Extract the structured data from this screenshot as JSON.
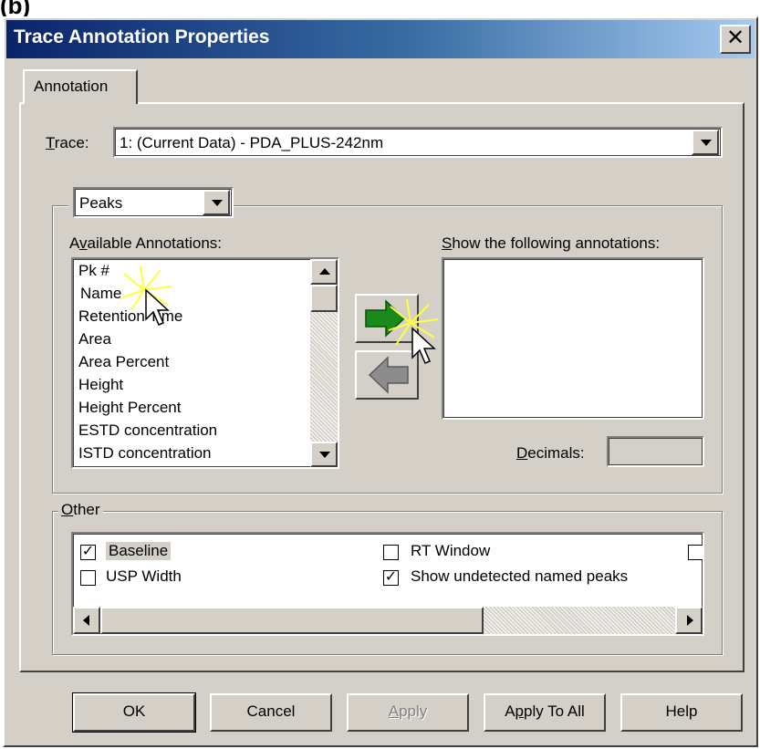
{
  "corner_label": "(b)",
  "window": {
    "title": "Trace Annotation Properties",
    "close_glyph": "✕"
  },
  "tabs": [
    {
      "label": "Annotation"
    }
  ],
  "trace": {
    "label_access": "T",
    "label_rest": "race:",
    "value": "1: (Current Data) - PDA_PLUS-242nm"
  },
  "peaks_group": {
    "dropdown_value": "Peaks",
    "available_label_pre": "A",
    "available_label_access": "v",
    "available_label_post": "ailable Annotations:",
    "show_label_access": "S",
    "show_label_rest": "how the following annotations:",
    "available_items": [
      "Pk #",
      "Name",
      "Retention Time",
      "Area",
      "Area Percent",
      "Height",
      "Height Percent",
      "ESTD concentration",
      "ISTD concentration"
    ],
    "selected_item": "Name",
    "show_items": [],
    "decimals_label_access": "D",
    "decimals_label_rest": "ecimals:",
    "decimals_value": ""
  },
  "other_group": {
    "label_access": "O",
    "label_rest": "ther",
    "checkboxes": [
      {
        "label": "Baseline",
        "checked": true
      },
      {
        "label": "RT Window",
        "checked": false
      },
      {
        "label": "USP Width",
        "checked": false
      },
      {
        "label": "Show undetected named peaks",
        "checked": true
      }
    ]
  },
  "buttons": {
    "ok": "OK",
    "cancel": "Cancel",
    "apply_access": "A",
    "apply_rest": "pply",
    "apply_to_all_pre": "A",
    "apply_to_all_access": "p",
    "apply_to_all_post": "ply To All",
    "help": "Help"
  },
  "colors": {
    "dialog_face": "#d4d0c8",
    "title_start": "#0a246a",
    "title_end": "#a6caf0",
    "selection": "#0a246a",
    "add_arrow": "#1a8a1a",
    "remove_arrow": "#8c8c8c",
    "sparkle": "#ffff40"
  }
}
